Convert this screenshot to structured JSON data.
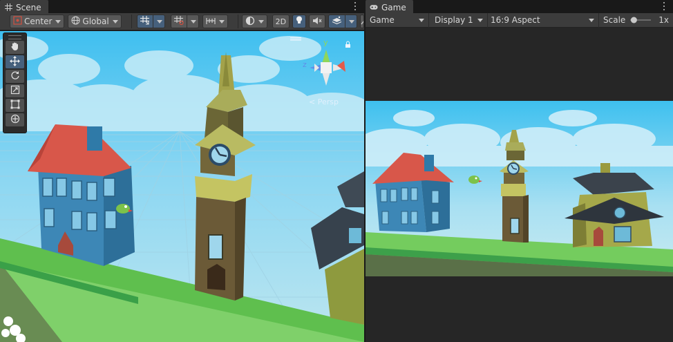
{
  "scene_tab": {
    "label": "Scene",
    "icon": "grid-icon"
  },
  "game_tab": {
    "label": "Game",
    "icon": "gamepad-icon"
  },
  "scene_toolbar": {
    "pivot_label": "Center",
    "space_label": "Global",
    "mode_2d_label": "2D"
  },
  "tools": [
    "hand-tool",
    "move-tool",
    "rotate-tool",
    "scale-tool",
    "rect-tool",
    "transform-tool"
  ],
  "gizmo": {
    "y_label": "y",
    "z_label": "z",
    "projection_label": "Persp"
  },
  "game_toolbar": {
    "view_select": "Game",
    "display_select": "Display 1",
    "aspect_select": "16:9 Aspect",
    "scale_label": "Scale",
    "scale_value": "1x",
    "scale_level": 0.1
  },
  "colors": {
    "sky": "#4cc4ee",
    "ground": "#72c95a",
    "selected": "#46607c"
  }
}
